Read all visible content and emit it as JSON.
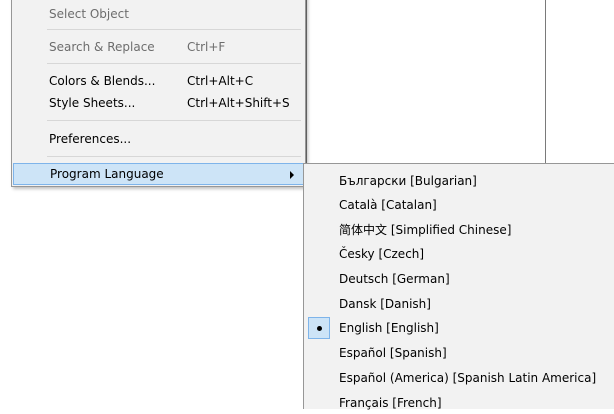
{
  "menu": {
    "items": [
      {
        "label": "Select Object",
        "shortcut": ""
      },
      {
        "label": "Search & Replace",
        "shortcut": "Ctrl+F"
      },
      {
        "label": "Colors & Blends...",
        "shortcut": "Ctrl+Alt+C"
      },
      {
        "label": "Style Sheets...",
        "shortcut": "Ctrl+Alt+Shift+S"
      },
      {
        "label": "Preferences...",
        "shortcut": ""
      },
      {
        "label": "Program Language",
        "shortcut": ""
      }
    ]
  },
  "submenu": {
    "items": [
      {
        "label": "Български [Bulgarian]"
      },
      {
        "label": "Català [Catalan]"
      },
      {
        "label": "简体中文 [Simplified Chinese]"
      },
      {
        "label": "Česky [Czech]"
      },
      {
        "label": "Deutsch [German]"
      },
      {
        "label": "Dansk [Danish]"
      },
      {
        "label": "English [English]"
      },
      {
        "label": "Español [Spanish]"
      },
      {
        "label": "Español (America) [Spanish Latin America]"
      },
      {
        "label": "Français [French]"
      }
    ]
  },
  "colors": {
    "menu_bg": "#f2f2f2",
    "highlight_bg": "#cde4f7",
    "highlight_border": "#7eb4ea",
    "disabled_text": "#6d6d6d"
  }
}
